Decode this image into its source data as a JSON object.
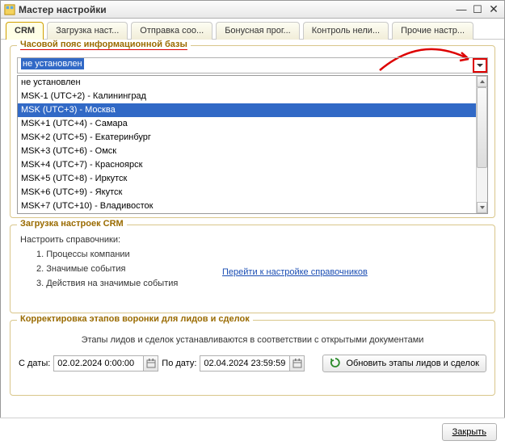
{
  "window": {
    "title": "Мастер настройки"
  },
  "tabs": [
    {
      "label": "CRM",
      "active": true
    },
    {
      "label": "Загрузка наст...",
      "active": false
    },
    {
      "label": "Отправка соо...",
      "active": false
    },
    {
      "label": "Бонусная прог...",
      "active": false
    },
    {
      "label": "Контроль нели...",
      "active": false
    },
    {
      "label": "Прочие настр...",
      "active": false
    }
  ],
  "tz_group": {
    "title": "Часовой пояс информационной базы",
    "selected": "не установлен",
    "options": [
      {
        "label": "не установлен",
        "sel": false
      },
      {
        "label": "MSK-1 (UTC+2) - Калининград",
        "sel": false
      },
      {
        "label": "MSK (UTC+3) - Москва",
        "sel": true
      },
      {
        "label": "MSK+1 (UTC+4) - Самара",
        "sel": false
      },
      {
        "label": "MSK+2 (UTC+5) - Екатеринбург",
        "sel": false
      },
      {
        "label": "MSK+3 (UTC+6) - Омск",
        "sel": false
      },
      {
        "label": "MSK+4 (UTC+7) - Красноярск",
        "sel": false
      },
      {
        "label": "MSK+5 (UTC+8) - Иркутск",
        "sel": false
      },
      {
        "label": "MSK+6 (UTC+9) - Якутск",
        "sel": false
      },
      {
        "label": "MSK+7 (UTC+10) - Владивосток",
        "sel": false
      }
    ]
  },
  "crm_group": {
    "title": "Загрузка настроек CRM",
    "intro": "Настроить справочники:",
    "items": [
      "1. Процессы компании",
      "2. Значимые события",
      "3. Действия на значимые события"
    ],
    "link": "Перейти к настройке справочников"
  },
  "funnel_group": {
    "title": "Корректировка этапов воронки для лидов и сделок",
    "note": "Этапы лидов и сделок устанавливаются в соответствии с открытыми документами",
    "from_label": "С даты:",
    "from_value": "02.02.2024  0:00:00",
    "to_label": "По дату:",
    "to_value": "02.04.2024 23:59:59",
    "update_label": "Обновить этапы лидов и сделок"
  },
  "footer": {
    "close": "Закрыть"
  }
}
